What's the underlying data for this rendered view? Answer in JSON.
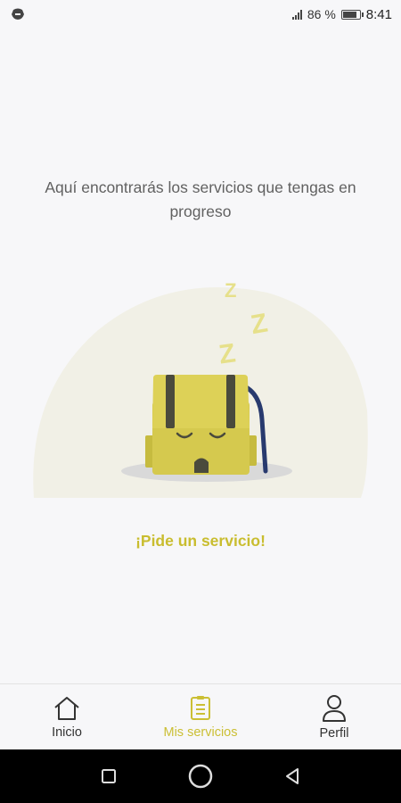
{
  "status_bar": {
    "battery_percent": "86 %",
    "time": "8:41",
    "icons": [
      "app-notification-icon",
      "signal-icon",
      "battery-icon"
    ]
  },
  "main": {
    "message": "Aquí encontrarás los servicios que tengas en progreso",
    "illustration": "sleeping-backpack-icon",
    "sleep_letters": [
      "Z",
      "Z",
      "Z"
    ],
    "cta_label": "¡Pide un servicio!"
  },
  "bottom_nav": {
    "items": [
      {
        "label": "Inicio",
        "icon": "home-icon",
        "active": false
      },
      {
        "label": "Mis servicios",
        "icon": "document-list-icon",
        "active": true
      },
      {
        "label": "Perfil",
        "icon": "user-icon",
        "active": false
      }
    ]
  },
  "system_nav": {
    "icons": [
      "recents-icon",
      "home-circle-icon",
      "back-icon"
    ]
  },
  "colors": {
    "accent": "#cbbf34",
    "backpack": "#d8cc4f",
    "background": "#f7f7f9",
    "strap": "#283a6e"
  }
}
